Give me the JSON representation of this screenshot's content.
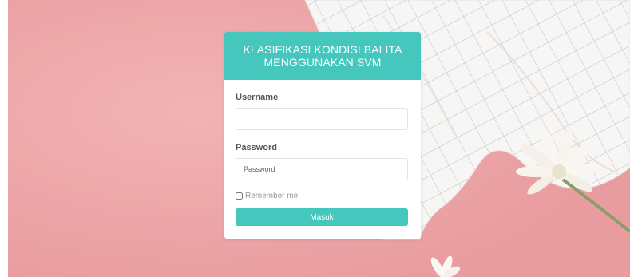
{
  "login": {
    "title_line1": "KLASIFIKASI KONDISI BALITA",
    "title_line2": "MENGGUNAKAN SVM",
    "username_label": "Username",
    "username_value": "",
    "password_label": "Password",
    "password_placeholder": "Password",
    "remember_label": "Remember me",
    "submit_label": "Masuk"
  },
  "colors": {
    "accent": "#45c7bd",
    "background_pink": "#eda4a6"
  },
  "icons": {
    "checkbox": "checkbox-unchecked-icon"
  }
}
